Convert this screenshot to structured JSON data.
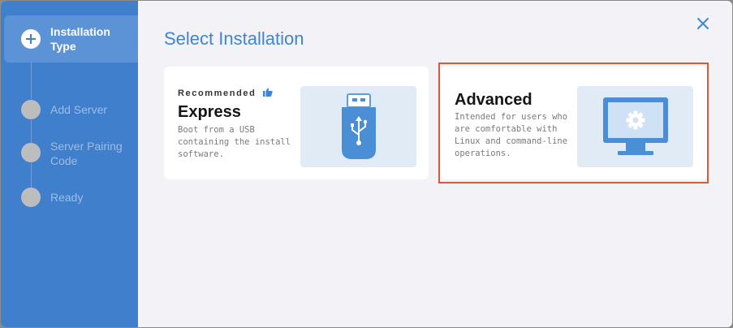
{
  "dialog": {
    "title": "Select Installation"
  },
  "steps": [
    {
      "label": "Installation Type",
      "active": true
    },
    {
      "label": "Add Server",
      "active": false
    },
    {
      "label": "Server Pairing Code",
      "active": false
    },
    {
      "label": "Ready",
      "active": false
    }
  ],
  "options": {
    "express": {
      "badge": "Recommended",
      "title": "Express",
      "description": "Boot from a USB containing the install software.",
      "icon": "usb-drive-icon"
    },
    "advanced": {
      "title": "Advanced",
      "description": "Intended for users who are comfortable with Linux and command-line operations.",
      "icon": "monitor-settings-icon",
      "highlighted": true
    }
  },
  "colors": {
    "sidebar": "#3f7fcb",
    "accent": "#3f85d1",
    "highlight": "#d95a3b",
    "background": "#f3f2f7"
  }
}
